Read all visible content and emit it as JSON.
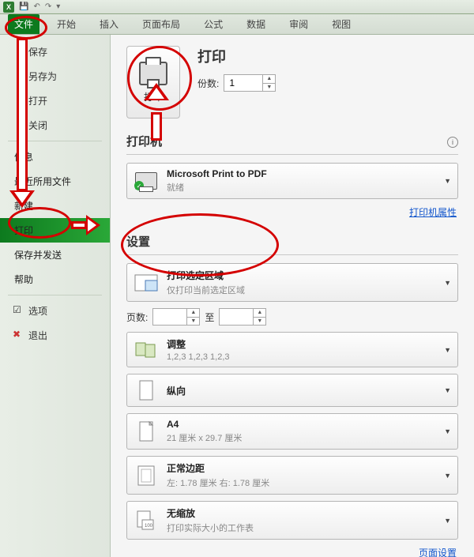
{
  "tabs": {
    "file": "文件",
    "home": "开始",
    "insert": "插入",
    "layout": "页面布局",
    "formula": "公式",
    "data": "数据",
    "review": "审阅",
    "view": "视图"
  },
  "sidebar": {
    "save": "保存",
    "saveas": "另存为",
    "open": "打开",
    "close": "关闭",
    "info": "信息",
    "recent": "最近所用文件",
    "new": "新建",
    "print": "打印",
    "share": "保存并发送",
    "help": "帮助",
    "options": "选项",
    "exit": "退出"
  },
  "print": {
    "title": "打印",
    "btn": "打印",
    "copies_label": "份数:",
    "copies_value": "1",
    "printer_section": "打印机",
    "printer_name": "Microsoft Print to PDF",
    "printer_status": "就绪",
    "printer_props": "打印机属性",
    "settings_section": "设置",
    "sel_area": "打印选定区域",
    "sel_area_sub": "仅打印当前选定区域",
    "pages_label": "页数:",
    "pages_to": "至",
    "collate": "调整",
    "collate_sub": "1,2,3    1,2,3    1,2,3",
    "orient": "纵向",
    "paper": "A4",
    "paper_sub": "21 厘米 x 29.7 厘米",
    "margin": "正常边距",
    "margin_sub": "左: 1.78 厘米   右: 1.78 厘米",
    "zoom": "无缩放",
    "zoom_sub": "打印实际大小的工作表",
    "page_setup": "页面设置"
  }
}
